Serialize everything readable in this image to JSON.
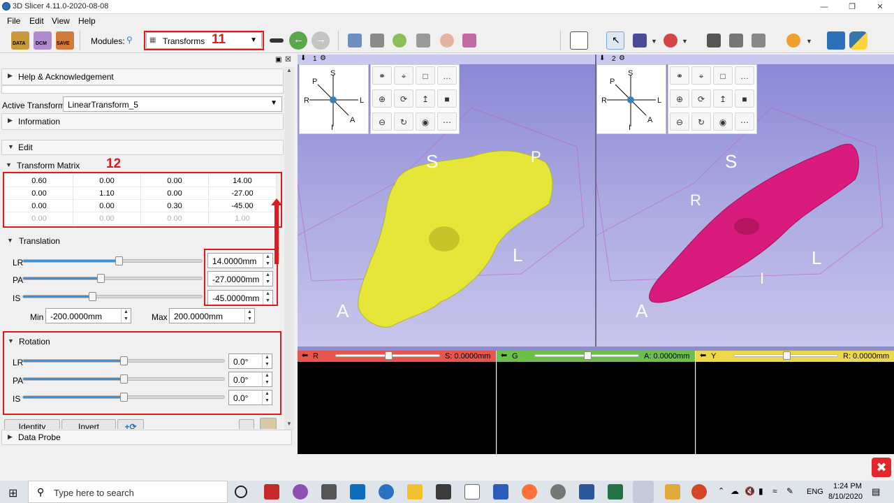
{
  "window": {
    "title": "3D Slicer 4.11.0-2020-08-08"
  },
  "menu": [
    "File",
    "Edit",
    "View",
    "Help"
  ],
  "toolbar": {
    "data_label": "DATA",
    "dcm_label": "DCM",
    "save_label": "SAVE",
    "modules_label": "Modules:",
    "module_selected": "Transforms"
  },
  "annotations": {
    "label_11": "11",
    "label_12": "12",
    "accent_color": "#e0191c"
  },
  "panel": {
    "help_section": "Help & Acknowledgement",
    "active_transform_label": "Active Transform:",
    "active_transform_value": "LinearTransform_5",
    "information_section": "Information",
    "edit_section": "Edit",
    "transform_matrix_label": "Transform Matrix",
    "matrix": [
      [
        "0.60",
        "0.00",
        "0.00",
        "14.00"
      ],
      [
        "0.00",
        "1.10",
        "0.00",
        "-27.00"
      ],
      [
        "0.00",
        "0.00",
        "0.30",
        "-45.00"
      ],
      [
        "0.00",
        "0.00",
        "0.00",
        "1.00"
      ]
    ],
    "translation_label": "Translation",
    "translation": [
      {
        "axis": "LR",
        "value": "14.0000mm",
        "level": 0.535
      },
      {
        "axis": "PA",
        "value": "-27.0000mm",
        "level": 0.4325
      },
      {
        "axis": "IS",
        "value": "-45.0000mm",
        "level": 0.3875
      }
    ],
    "min_label": "Min",
    "min_value": "-200.0000mm",
    "max_label": "Max",
    "max_value": "200.0000mm",
    "rotation_label": "Rotation",
    "rotation": [
      {
        "axis": "LR",
        "value": "0.0°",
        "level": 0.5
      },
      {
        "axis": "PA",
        "value": "0.0°",
        "level": 0.5
      },
      {
        "axis": "IS",
        "value": "0.0°",
        "level": 0.5
      }
    ],
    "identity_button": "Identity",
    "invert_button": "Invert",
    "data_probe_section": "Data Probe"
  },
  "views": {
    "view1_number": "1",
    "view2_number": "2",
    "view1_labels": {
      "S": "S",
      "P": "P",
      "L": "L",
      "A": "A"
    },
    "view2_labels": {
      "S": "S",
      "R": "R",
      "L": "L",
      "I": "I",
      "A": "A"
    },
    "orientation": {
      "S": "S",
      "P": "P",
      "R": "R",
      "L": "L",
      "I": "I",
      "A": "A"
    },
    "skull1_color": "#e6e63a",
    "skull2_color": "#d81b7d"
  },
  "slices": {
    "red": {
      "letter": "R",
      "readout": "S: 0.0000mm",
      "color": "#e8554e"
    },
    "green": {
      "letter": "G",
      "readout": "A: 0.0000mm",
      "color": "#6dbf4b"
    },
    "yellow": {
      "letter": "Y",
      "readout": "R: 0.0000mm",
      "color": "#ecd94a"
    }
  },
  "taskbar": {
    "search_placeholder": "Type here to search",
    "language": "ENG",
    "time": "1:24 PM",
    "date": "8/10/2020"
  }
}
